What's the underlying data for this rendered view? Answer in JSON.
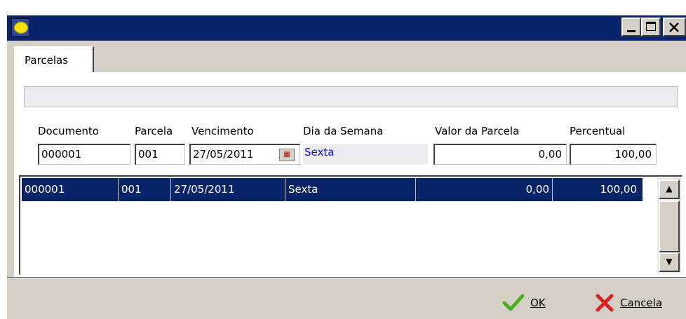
{
  "window": {
    "title": "",
    "app_icon": "app-icon",
    "controls": [
      "minimize-icon",
      "maximize-icon",
      "close-icon"
    ]
  },
  "tabs": [
    {
      "label": "Parcelas"
    }
  ],
  "form": {
    "labels": {
      "documento": "Documento",
      "parcela": "Parcela",
      "vencimento": "Vencimento",
      "dia_semana": "Dia da Semana",
      "valor_parcela": "Valor da Parcela",
      "percentual": "Percentual"
    },
    "values": {
      "documento": "000001",
      "parcela": "001",
      "vencimento": "27/05/2011",
      "dia_semana": "Sexta",
      "valor_parcela": "0,00",
      "percentual": "100,00"
    }
  },
  "grid": {
    "rows": [
      {
        "documento": "000001",
        "parcela": "001",
        "vencimento": "27/05/2011",
        "dia": "Sexta",
        "valor": "0,00",
        "percentual": "100,00"
      }
    ]
  },
  "actions": {
    "ok": "OK",
    "cancel": "Cancela"
  },
  "colors": {
    "titlebar": "#0a246a",
    "face": "#d4d0c8",
    "selection": "#0a246a",
    "dia_text": "#1010e0",
    "ok_icon": "#4caf20",
    "cancel_icon": "#e02020"
  }
}
